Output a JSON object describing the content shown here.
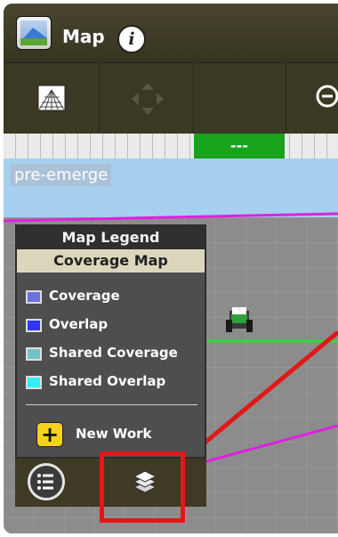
{
  "window": {
    "title": "Map",
    "app_icon": "map-app-icon",
    "info_icon": "info-icon"
  },
  "toolbar": {
    "buttons": [
      {
        "name": "grid-view-button",
        "icon": "grid-perspective-icon"
      },
      {
        "name": "pan-button",
        "icon": "pan-arrows-icon",
        "state": "disabled"
      },
      {
        "name": "blank-button"
      },
      {
        "name": "zoom-out-button",
        "icon": "zoom-out-icon"
      }
    ]
  },
  "progress": {
    "label": "---",
    "fill_color": "#18a31c"
  },
  "map": {
    "field_name": "pre-emerge",
    "boundary_color": "#e020e0",
    "guidance_line_color": "#2fdc2f",
    "vehicle_icon": "tractor-icon"
  },
  "legend": {
    "title": "Map Legend",
    "subtitle": "Coverage Map",
    "items": [
      {
        "label": "Coverage",
        "color": "#6b6fe0"
      },
      {
        "label": "Overlap",
        "color": "#2f35f0"
      },
      {
        "label": "Shared Coverage",
        "color": "#72c3c9"
      },
      {
        "label": "Shared Overlap",
        "color": "#2ff0f0"
      }
    ],
    "new_work_label": "New Work"
  },
  "bottom_bar": {
    "list_icon": "list-icon",
    "layers_icon": "layers-icon"
  },
  "annotation": {
    "color": "#e21818"
  }
}
